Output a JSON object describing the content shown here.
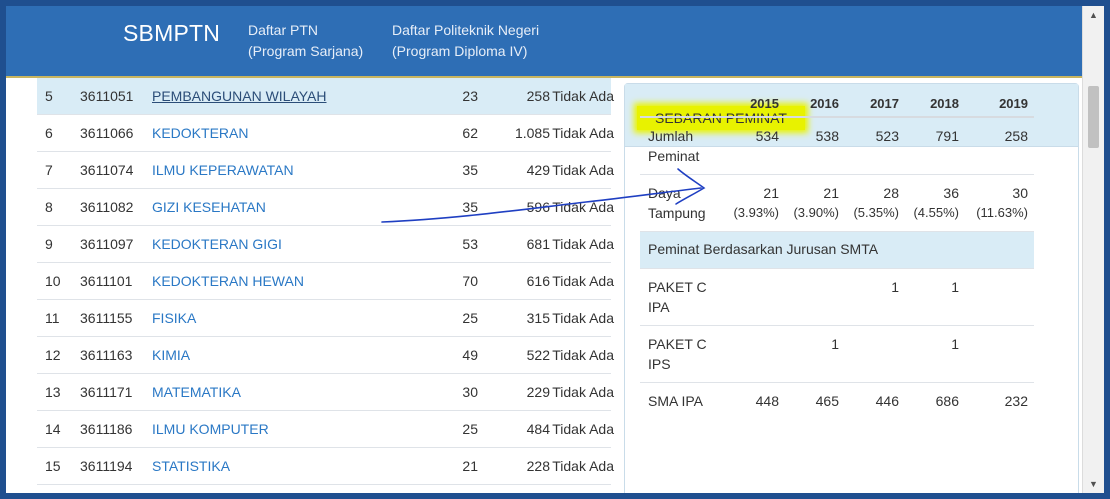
{
  "header": {
    "brand": "SBMPTN",
    "nav": [
      {
        "line1": "Daftar PTN",
        "line2": "(Program Sarjana)"
      },
      {
        "line1": "Daftar Politeknik Negeri",
        "line2": "(Program Diploma IV)"
      }
    ]
  },
  "table": {
    "rows": [
      {
        "no": "5",
        "code": "3611051",
        "name": "PEMBANGUNAN WILAYAH",
        "capacity": "23",
        "applicants": "258",
        "status": "Tidak Ada"
      },
      {
        "no": "6",
        "code": "3611066",
        "name": "KEDOKTERAN",
        "capacity": "62",
        "applicants": "1.085",
        "status": "Tidak Ada"
      },
      {
        "no": "7",
        "code": "3611074",
        "name": "ILMU KEPERAWATAN",
        "capacity": "35",
        "applicants": "429",
        "status": "Tidak Ada"
      },
      {
        "no": "8",
        "code": "3611082",
        "name": "GIZI KESEHATAN",
        "capacity": "35",
        "applicants": "596",
        "status": "Tidak Ada"
      },
      {
        "no": "9",
        "code": "3611097",
        "name": "KEDOKTERAN GIGI",
        "capacity": "53",
        "applicants": "681",
        "status": "Tidak Ada"
      },
      {
        "no": "10",
        "code": "3611101",
        "name": "KEDOKTERAN HEWAN",
        "capacity": "70",
        "applicants": "616",
        "status": "Tidak Ada"
      },
      {
        "no": "11",
        "code": "3611155",
        "name": "FISIKA",
        "capacity": "25",
        "applicants": "315",
        "status": "Tidak Ada"
      },
      {
        "no": "12",
        "code": "3611163",
        "name": "KIMIA",
        "capacity": "49",
        "applicants": "522",
        "status": "Tidak Ada"
      },
      {
        "no": "13",
        "code": "3611171",
        "name": "MATEMATIKA",
        "capacity": "30",
        "applicants": "229",
        "status": "Tidak Ada"
      },
      {
        "no": "14",
        "code": "3611186",
        "name": "ILMU KOMPUTER",
        "capacity": "25",
        "applicants": "484",
        "status": "Tidak Ada"
      },
      {
        "no": "15",
        "code": "3611194",
        "name": "STATISTIKA",
        "capacity": "21",
        "applicants": "228",
        "status": "Tidak Ada"
      }
    ],
    "selected_index": 0
  },
  "panel": {
    "title": "SEBARAN PEMINAT",
    "years": [
      "2015",
      "2016",
      "2017",
      "2018",
      "2019"
    ],
    "jumlah": {
      "label1": "Jumlah",
      "label2": "Peminat",
      "values": [
        "534",
        "538",
        "523",
        "791",
        "258"
      ]
    },
    "daya": {
      "label1": "Daya",
      "label2": "Tampung",
      "values": [
        "21",
        "21",
        "28",
        "36",
        "30"
      ],
      "pct": [
        "(3.93%)",
        "(3.90%)",
        "(5.35%)",
        "(4.55%)",
        "(11.63%)"
      ]
    },
    "section_label": "Peminat Berdasarkan Jurusan SMTA",
    "smta": [
      {
        "label1": "PAKET C",
        "label2": "IPA",
        "values": [
          "",
          "",
          "1",
          "1",
          ""
        ]
      },
      {
        "label1": "PAKET C",
        "label2": "IPS",
        "values": [
          "",
          "1",
          "",
          "1",
          ""
        ]
      },
      {
        "label1": "SMA IPA",
        "label2": "",
        "values": [
          "448",
          "465",
          "446",
          "686",
          "232"
        ]
      }
    ]
  },
  "colors": {
    "navbar": "#2e6eb5",
    "link": "#2a78c5",
    "selected_row": "#d9ecf6",
    "highlight": "#e8f200",
    "ink": "#1f3fc2"
  }
}
